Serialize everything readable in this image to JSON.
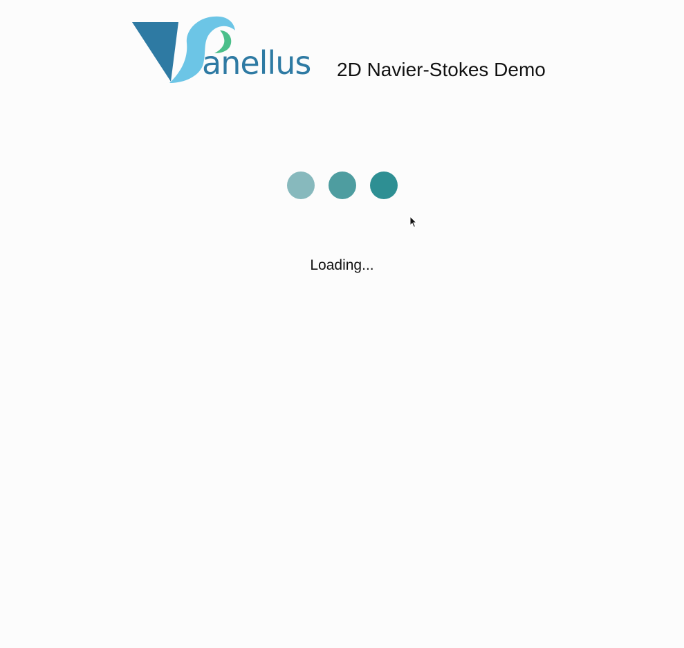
{
  "header": {
    "logo_text": "anellus",
    "subtitle": "2D Navier-Stokes Demo"
  },
  "loader": {
    "dot_colors": [
      "#87b9bd",
      "#4e9da0",
      "#2e8f93"
    ],
    "status_text": "Loading..."
  },
  "colors": {
    "brand_dark": "#2e7aa3",
    "brand_light": "#6cc5e6",
    "brand_green": "#4bbf8a",
    "background": "#fcfcfc"
  }
}
